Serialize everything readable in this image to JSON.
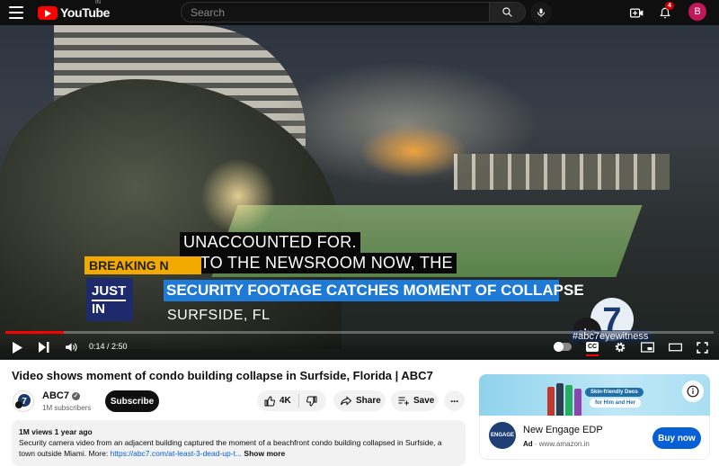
{
  "header": {
    "brand": "YouTube",
    "country_code": "IN",
    "search_placeholder": "Search",
    "notifications_count": "4",
    "avatar_letter": "B"
  },
  "player": {
    "captions": [
      "UNACCOUNTED FOR.",
      "INTO THE NEWSROOM NOW, THE"
    ],
    "lower_third": {
      "breaking": "BREAKING N",
      "just_in_1": "JUST",
      "just_in_2": "IN",
      "headline": "SECURITY FOOTAGE CATCHES MOMENT OF COLLAPSE",
      "location": "SURFSIDE, FL"
    },
    "network_logo": "abc",
    "network_number": "7",
    "hashtag": "#abc7eyewitness",
    "time_current": "0:14",
    "time_total": "2:50",
    "time_display": "0:14 / 2:50",
    "progress_fraction": 0.082,
    "cc_label": "CC"
  },
  "video": {
    "title": "Video shows moment of condo building collapse in Surfside, Florida | ABC7",
    "channel": {
      "name": "ABC7",
      "subscribers": "1M subscribers",
      "avatar_label": "abc7",
      "subscribe_label": "Subscribe"
    },
    "actions": {
      "likes": "4K",
      "share": "Share",
      "save": "Save"
    },
    "description": {
      "meta": "1M views  1 year ago",
      "text": "Security camera video from an adjacent building captured the moment of a beachfront condo building collapsed in Surfside, a town outside Miami. More: ",
      "link": "https://abc7.com/at-least-3-dead-up-t...",
      "show_more": "Show more"
    }
  },
  "ad": {
    "banner_pill_1": "Skin-friendly Deos",
    "banner_pill_2": "for Him and Her",
    "logo_text": "ENGAGE",
    "title": "New Engage EDP",
    "badge": "Ad",
    "domain": "www.amazon.in",
    "cta": "Buy now"
  },
  "colors": {
    "brand_red": "#ff0000",
    "accent_blue": "#065fd4",
    "headline_blue": "#1f7ad6",
    "breaking_yellow": "#f2a900"
  }
}
